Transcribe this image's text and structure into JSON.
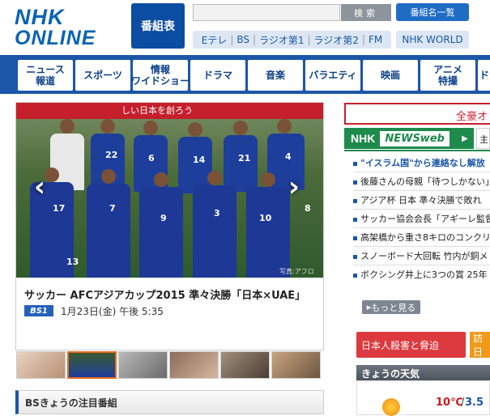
{
  "header": {
    "logo_line1": "NHK",
    "logo_line2": "ONLINE",
    "program_table": "番組表",
    "search_placeholder": "",
    "search_button": "検索",
    "program_list_button": "番組名一覧",
    "channels": [
      "Eテレ",
      "BS",
      "ラジオ第1",
      "ラジオ第2",
      "FM"
    ],
    "world_button": "NHK WORLD"
  },
  "genre_nav": {
    "items": [
      "ニュース\n報道",
      "スポーツ",
      "情報\nワイドショー",
      "ドラマ",
      "音楽",
      "バラエティ",
      "映画",
      "アニメ\n特撮",
      "ドキ"
    ]
  },
  "feature": {
    "banner_text": "しい日本を創ろう",
    "photo_credit": "写真:アフロ",
    "prev_icon": "‹",
    "next_icon": "›",
    "title": "サッカー AFCアジアカップ2015 準々決勝「日本×UAE」",
    "channel_badge": "BS1",
    "date": "1月23日(金) 午後 5:35",
    "jersey_numbers": [
      "22",
      "6",
      "14",
      "21",
      "4",
      "17",
      "7",
      "9",
      "3",
      "10",
      "8",
      "13"
    ]
  },
  "thumbs": {
    "count": 6
  },
  "bs_today": "BSきょうの注目番組",
  "right": {
    "alert_text": "全豪オ",
    "newsweb_nhk": "NHK",
    "newsweb_label": "NEWSweb",
    "side_tab": "主",
    "news": [
      "\"イスラム国\"から連絡なし解放",
      "後藤さんの母親「待つしかない」",
      "アジア杯 日本 準々決勝で敗れ",
      "サッカー協会会長「アギーレ監督",
      "高架橋から重さ8キロのコンクリ",
      "スノーボード大回転 竹内が銅メ",
      "ボクシング井上に3つの賞 25年"
    ],
    "more_button": "もっと見る",
    "red_button": "日本人殺害と脅迫",
    "orange_button": "訪日",
    "weather_title": "きょうの天気",
    "temp_hi": "10℃",
    "temp_sep": "/",
    "temp_lo": "3.5"
  },
  "colors": {
    "brand_blue": "#1b56a8",
    "news_green": "#1e8a4c",
    "alert_red": "#c7222c"
  }
}
